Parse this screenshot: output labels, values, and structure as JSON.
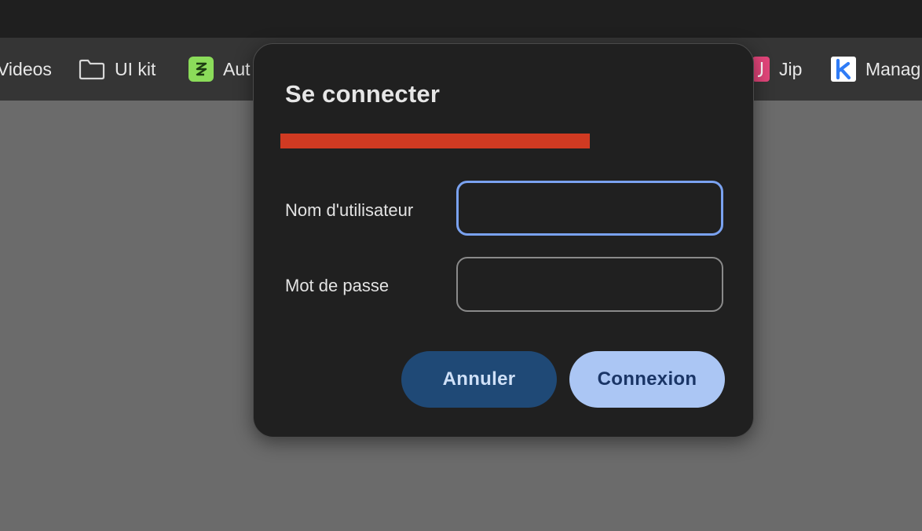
{
  "bookmarks": [
    {
      "label": "Videos",
      "icon": "none"
    },
    {
      "label": "UI kit",
      "icon": "folder-icon"
    },
    {
      "label": "Aut",
      "icon": "green-app-icon",
      "icon_color": "#8bdc5a"
    },
    {
      "label": "Jip",
      "icon": "pink-app-icon",
      "icon_color": "#e2457a"
    },
    {
      "label": "Manag",
      "icon": "k-app-icon",
      "icon_color": "#2f7cf6"
    }
  ],
  "dialog": {
    "title": "Se connecter",
    "username_label": "Nom d'utilisateur",
    "username_value": "",
    "password_label": "Mot de passe",
    "password_value": "",
    "cancel_label": "Annuler",
    "login_label": "Connexion"
  },
  "colors": {
    "accent_focus": "#7aa2f0",
    "primary_button": "#abc6f4",
    "secondary_button": "#1f4976",
    "redaction": "#d03a22"
  }
}
